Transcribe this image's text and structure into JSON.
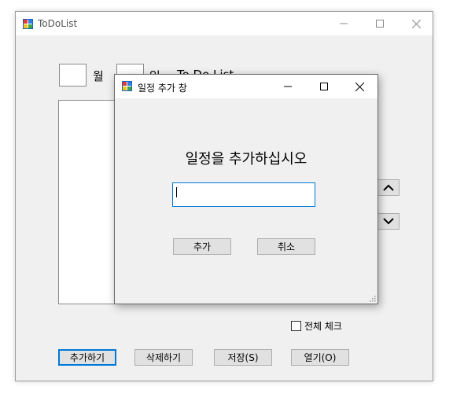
{
  "main_window": {
    "title": "ToDoList",
    "month_label": "월",
    "day_label": "일",
    "todo_header": "To Do List",
    "check_all_label": "전체 체크",
    "buttons": {
      "add": "추가하기",
      "delete": "삭제하기",
      "save": "저장(S)",
      "open": "열기(O)"
    }
  },
  "dialog": {
    "title": "일정 추가 창",
    "prompt": "일정을 추가하십시오",
    "input_value": "",
    "buttons": {
      "add": "추가",
      "cancel": "취소"
    }
  },
  "colors": {
    "accent": "#0078d7",
    "window_bg": "#f0f0f0"
  },
  "icons": [
    "app-icon",
    "minimize-icon",
    "maximize-icon",
    "close-icon",
    "chevron-up-icon",
    "chevron-down-icon",
    "resize-grip-icon"
  ]
}
